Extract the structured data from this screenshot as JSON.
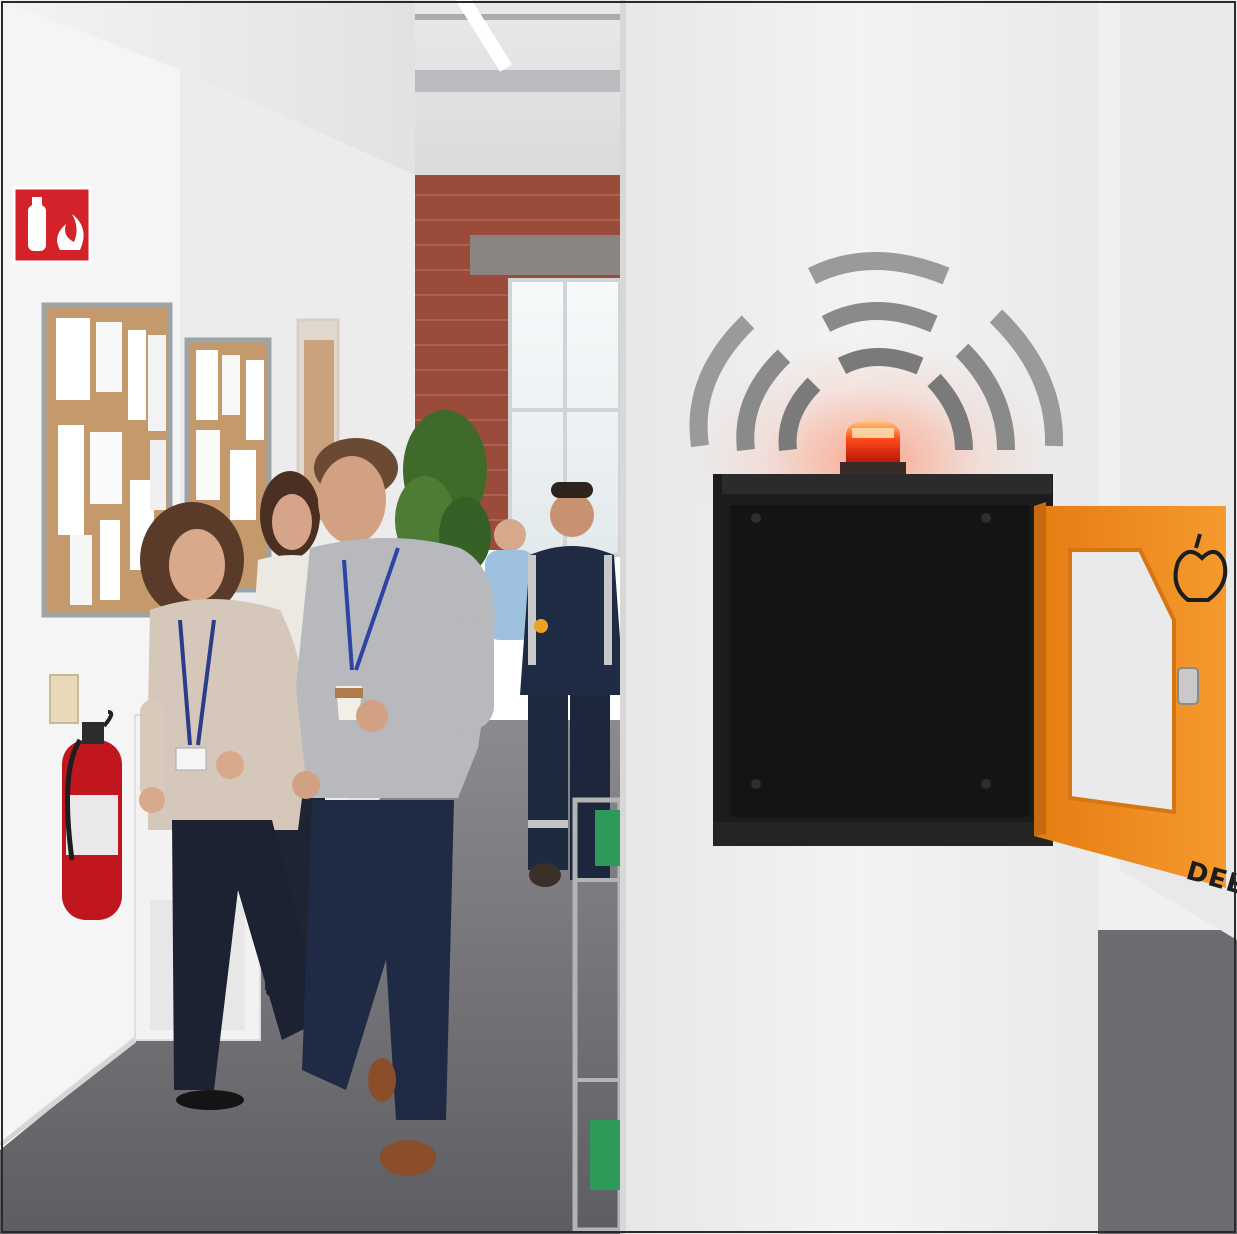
{
  "scene": {
    "kind": "photo",
    "description_visible_text": {
      "cabinet_door_label": "DEFIBRILATOR"
    },
    "colors": {
      "cabinet_door": "#f08a1c",
      "beacon": "#ff3b1a",
      "wall": "#f2f2f2",
      "brick": "#9b4b3a",
      "carpet": "#6e6e72",
      "fire_sign": "#d3222a",
      "extinguisher": "#c0171f",
      "signal_arcs": "#7a7a7a"
    },
    "icons": {
      "fire_sign": "fire-extinguisher-sign-icon",
      "door_logo": "heart-defibrillator-icon",
      "signal": "wifi-signal-arcs-icon"
    }
  }
}
